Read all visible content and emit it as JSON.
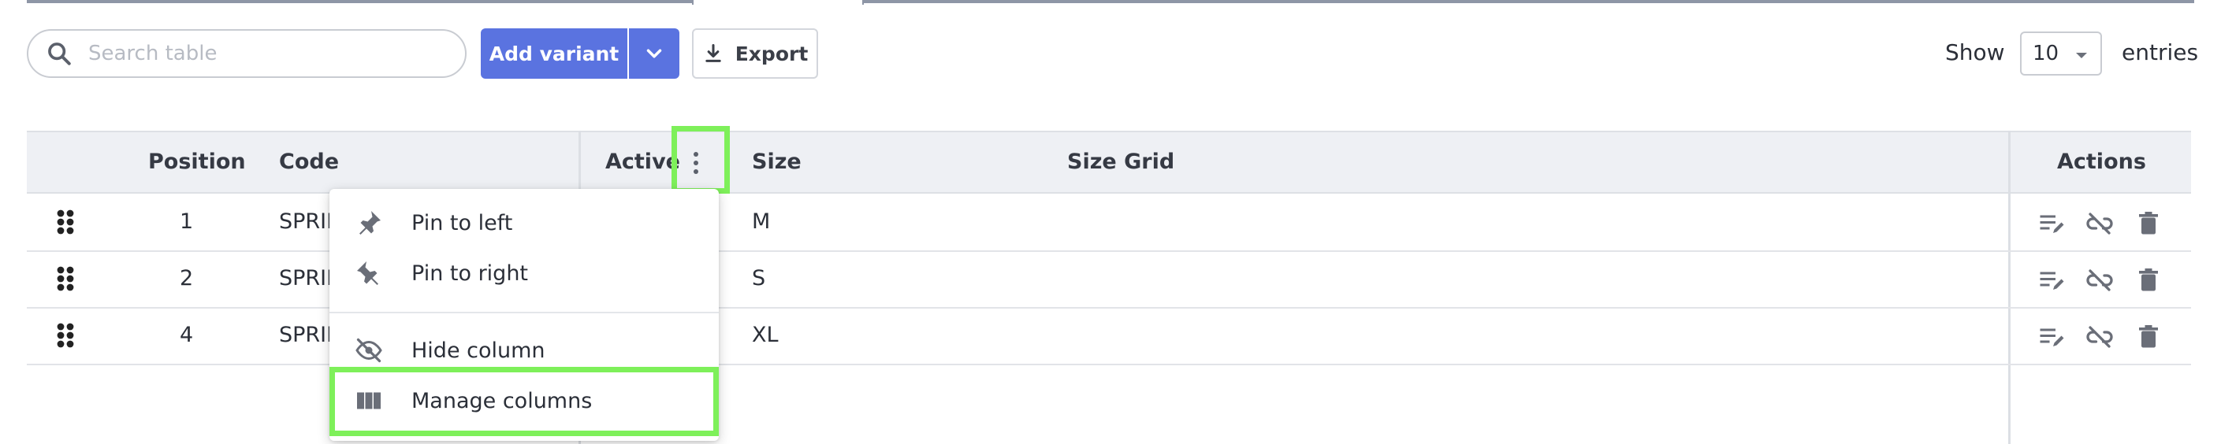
{
  "toolbar": {
    "search_placeholder": "Search table",
    "add_variant_label": "Add variant",
    "export_label": "Export",
    "show_label": "Show",
    "entries_value": "10",
    "entries_label": "entries"
  },
  "table": {
    "columns": {
      "position": "Position",
      "code": "Code",
      "active": "Active",
      "size": "Size",
      "size_grid": "Size Grid",
      "actions": "Actions"
    },
    "rows": [
      {
        "position": "1",
        "code": "SPRIN",
        "size": "M"
      },
      {
        "position": "2",
        "code": "SPRIN",
        "size": "S"
      },
      {
        "position": "4",
        "code": "SPRIN",
        "size": "XL"
      }
    ]
  },
  "column_menu": {
    "pin_left": "Pin to left",
    "pin_right": "Pin to right",
    "hide_column": "Hide column",
    "manage_columns": "Manage columns"
  },
  "colors": {
    "primary": "#5a73e0",
    "highlight": "#7ef05a",
    "header_bg": "#eef0f4"
  },
  "icons": [
    "search-icon",
    "chevron-down-icon",
    "download-icon",
    "drag-handle-icon",
    "kebab-menu-icon",
    "edit-icon",
    "unlink-icon",
    "trash-icon",
    "pin-left-icon",
    "pin-right-icon",
    "eye-off-icon",
    "columns-icon"
  ]
}
